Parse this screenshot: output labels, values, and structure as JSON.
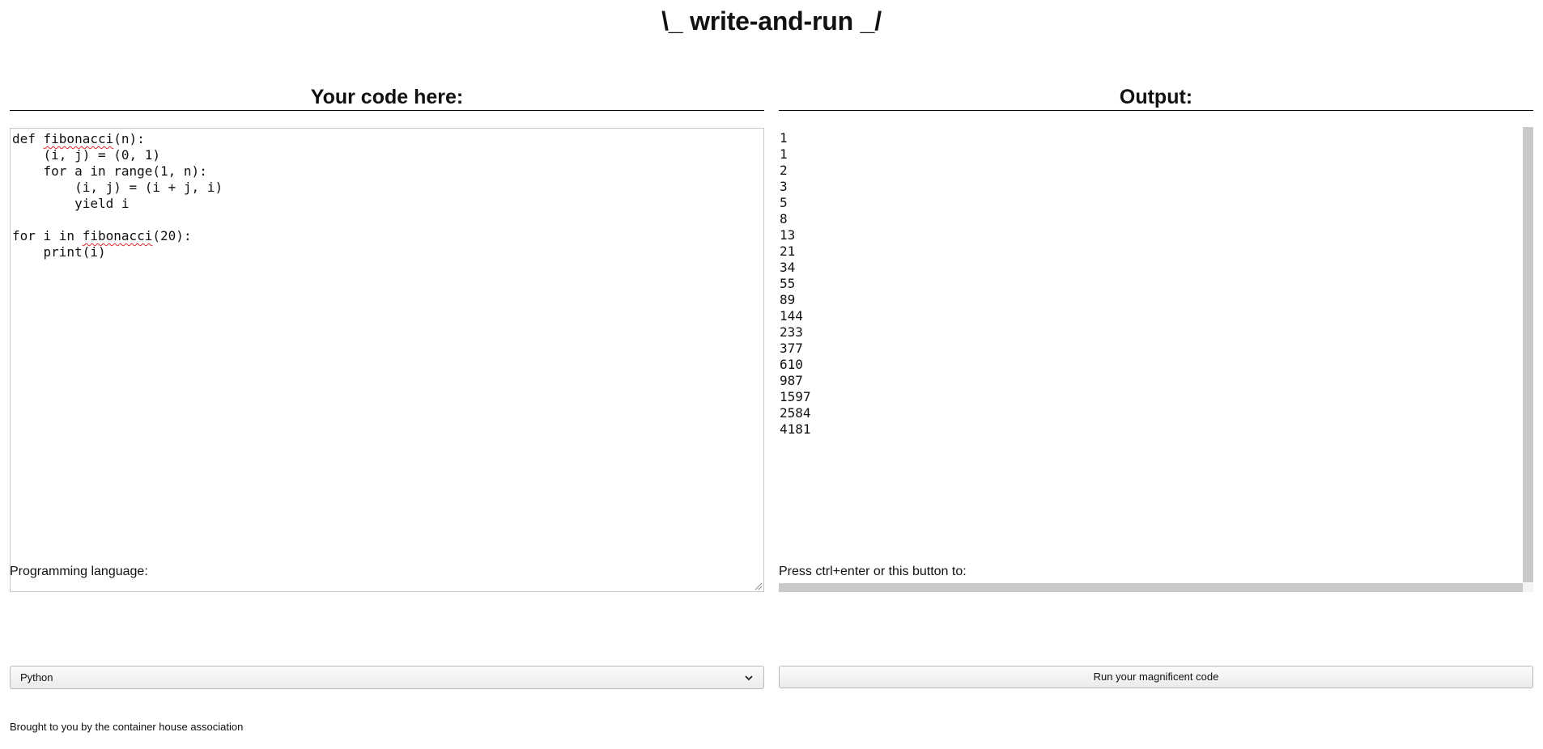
{
  "header": {
    "title": "\\_ write-and-run _/"
  },
  "editor": {
    "heading": "Your code here:",
    "lines": [
      [
        {
          "text": "def "
        },
        {
          "text": "fibonacci",
          "spell": true
        },
        {
          "text": "(n):"
        }
      ],
      [
        {
          "text": "    (i, j) = (0, 1)"
        }
      ],
      [
        {
          "text": "    for a in range(1, n):"
        }
      ],
      [
        {
          "text": "        (i, j) = (i + j, i)"
        }
      ],
      [
        {
          "text": "        yield i"
        }
      ],
      [
        {
          "text": ""
        }
      ],
      [
        {
          "text": "for i in "
        },
        {
          "text": "fibonacci",
          "spell": true
        },
        {
          "text": "(20):"
        }
      ],
      [
        {
          "text": "    print(i)"
        }
      ]
    ]
  },
  "output": {
    "heading": "Output:",
    "lines": [
      "1",
      "1",
      "2",
      "3",
      "5",
      "8",
      "13",
      "21",
      "34",
      "55",
      "89",
      "144",
      "233",
      "377",
      "610",
      "987",
      "1597",
      "2584",
      "4181"
    ]
  },
  "language": {
    "label": "Programming language:",
    "selected": "Python",
    "icon": "chevron-down-icon"
  },
  "run": {
    "label": "Press ctrl+enter or this button to:",
    "button_label": "Run your magnificent code"
  },
  "footer": {
    "text": "Brought to you by the container house association"
  },
  "colors": {
    "spellcheck_underline": "#e0242a",
    "scrollbar_thumb": "#c9c9c9",
    "border": "#c7c7c7"
  }
}
